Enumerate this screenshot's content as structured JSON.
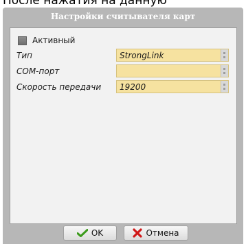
{
  "background_caption": "После нажатия на данную",
  "dialog": {
    "title": "Настройки считывателя карт"
  },
  "form": {
    "active_label": "Активный",
    "active_checked": false,
    "fields": [
      {
        "label": "Тип",
        "value": "StrongLink"
      },
      {
        "label": "COM-порт",
        "value": ""
      },
      {
        "label": "Скорость передачи",
        "value": "19200"
      }
    ]
  },
  "buttons": {
    "ok_label": "OK",
    "cancel_label": "Отмена"
  },
  "colors": {
    "combo_bg": "#f6e2a0",
    "ok_icon": "#3a9a1a",
    "cancel_icon": "#d01818"
  },
  "icons": {
    "ok": "check-icon",
    "cancel": "cross-icon"
  }
}
